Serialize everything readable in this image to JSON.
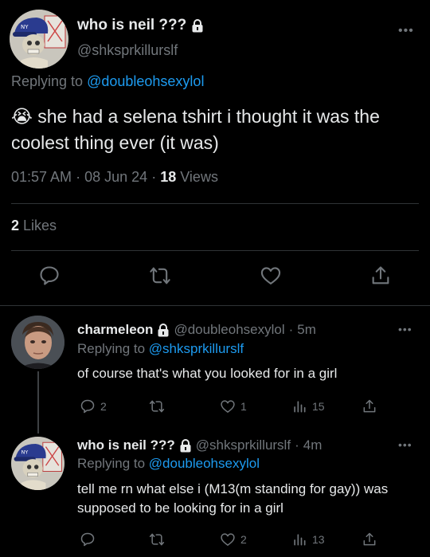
{
  "main_tweet": {
    "display_name": "who is neil ???",
    "handle": "@shksprkillurslf",
    "replying_label": "Replying to",
    "replying_to": "@doubleohsexylol",
    "text": "😭 she had a selena tshirt i thought it was the coolest thing ever (it was)",
    "time": "01:57 AM",
    "date": "08 Jun 24",
    "views_count": "18",
    "views_label": "Views",
    "likes_count": "2",
    "likes_label": "Likes",
    "more": "•••"
  },
  "replies": [
    {
      "display_name": "charmeleon",
      "handle": "@doubleohsexylol",
      "time_ago": "5m",
      "replying_label": "Replying to",
      "replying_to": "@shksprkillurslf",
      "text": "of course that's what you looked for in a girl",
      "replies_count": "2",
      "likes_count": "1",
      "views_count": "15",
      "more": "•••"
    },
    {
      "display_name": "who is neil ???",
      "handle": "@shksprkillurslf",
      "time_ago": "4m",
      "replying_label": "Replying to",
      "replying_to": "@doubleohsexylol",
      "text": "tell me rn what else i (M13(m standing for gay)) was supposed to be looking for in a girl",
      "likes_count": "2",
      "views_count": "13",
      "more": "•••"
    }
  ],
  "colors": {
    "background": "#000000",
    "text": "#e7e9ea",
    "muted": "#71767b",
    "link": "#1d9bf0",
    "divider": "#2f3336"
  },
  "separator": "·"
}
